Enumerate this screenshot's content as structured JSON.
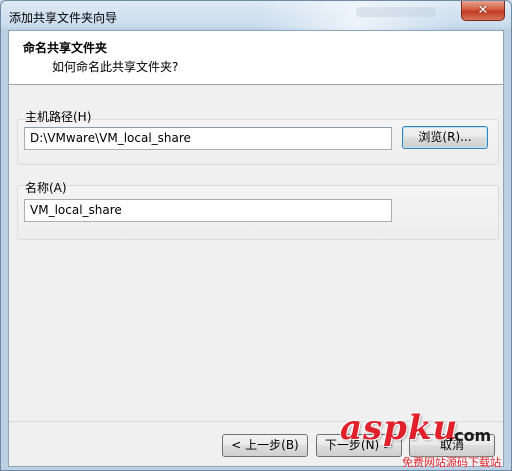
{
  "window": {
    "title": "添加共享文件夹向导",
    "close_label": "✕"
  },
  "header": {
    "title": "命名共享文件夹",
    "subtitle": "如何命名此共享文件夹?"
  },
  "host_path": {
    "label": "主机路径(H)",
    "value": "D:\\VMware\\VM_local_share",
    "browse_label": "浏览(R)..."
  },
  "name": {
    "label": "名称(A)",
    "value": "VM_local_share"
  },
  "footer": {
    "back_label": "< 上一步(B)",
    "next_label": "下一步(N) >",
    "cancel_label": "取消"
  },
  "watermark": {
    "brand": "aspku",
    "suffix": ".com",
    "tagline": "免费网站源码下载站"
  }
}
